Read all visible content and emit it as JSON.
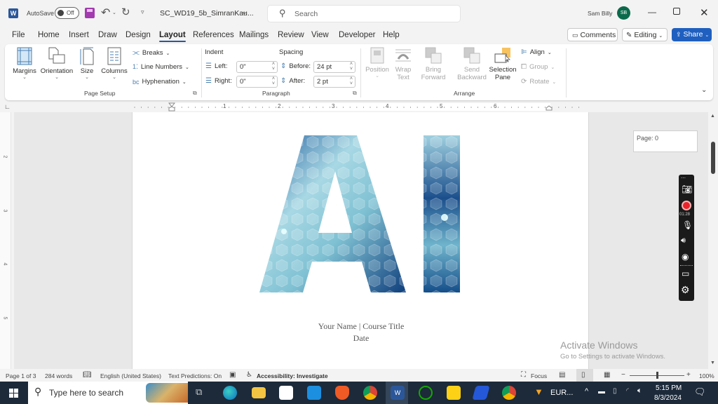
{
  "titlebar": {
    "autosave_label": "AutoSave",
    "autosave_state": "Off",
    "doc_title": "SC_WD19_5b_SimranKau...",
    "search_placeholder": "Search",
    "user_name": "Sam Billy",
    "user_initials": "SB"
  },
  "tabs": [
    "File",
    "Home",
    "Insert",
    "Draw",
    "Design",
    "Layout",
    "References",
    "Mailings",
    "Review",
    "View",
    "Developer",
    "Help"
  ],
  "active_tab": "Layout",
  "actions": {
    "comments": "Comments",
    "editing": "Editing",
    "share": "Share"
  },
  "ribbon": {
    "page_setup": {
      "label": "Page Setup",
      "margins": "Margins",
      "orientation": "Orientation",
      "size": "Size",
      "columns": "Columns",
      "breaks": "Breaks",
      "line_numbers": "Line Numbers",
      "hyphenation": "Hyphenation"
    },
    "paragraph": {
      "label": "Paragraph",
      "indent_label": "Indent",
      "spacing_label": "Spacing",
      "left_label": "Left:",
      "left_value": "0\"",
      "right_label": "Right:",
      "right_value": "0\"",
      "before_label": "Before:",
      "before_value": "24 pt",
      "after_label": "After:",
      "after_value": "2 pt"
    },
    "arrange": {
      "label": "Arrange",
      "position": "Position",
      "wrap_text_1": "Wrap",
      "wrap_text_2": "Text",
      "bring_forward_1": "Bring",
      "bring_forward_2": "Forward",
      "send_backward_1": "Send",
      "send_backward_2": "Backward",
      "selection_pane_1": "Selection",
      "selection_pane_2": "Pane",
      "align": "Align",
      "group": "Group",
      "rotate": "Rotate"
    }
  },
  "ruler": {
    "h_numbers": [
      "1",
      "2",
      "3",
      "4",
      "5",
      "6"
    ],
    "v_numbers": [
      "2",
      "3",
      "4",
      "5"
    ]
  },
  "document": {
    "cover_text": "AI",
    "name_line": "Your Name | Course Title",
    "date_line": "Date"
  },
  "page_box": "Page: 0",
  "recorder": {
    "timer": "01:28",
    "record_color": "#e8232b"
  },
  "watermark": {
    "title": "Activate Windows",
    "subtitle": "Go to Settings to activate Windows."
  },
  "statusbar": {
    "page": "Page 1 of 3",
    "words": "284 words",
    "language": "English (United States)",
    "predictions": "Text Predictions: On",
    "accessibility": "Accessibility: Investigate",
    "focus": "Focus",
    "zoom": "100%",
    "zoom_fraction": 0.5
  },
  "taskbar": {
    "search_placeholder": "Type here to search",
    "tray_label": "EUR...",
    "time": "5:15 PM",
    "date": "8/3/2024"
  },
  "colors": {
    "word_blue": "#2b579a",
    "share_blue": "#1f5fbf",
    "avatar_green": "#0b6a4b",
    "taskbar": "#1c2a3a"
  }
}
